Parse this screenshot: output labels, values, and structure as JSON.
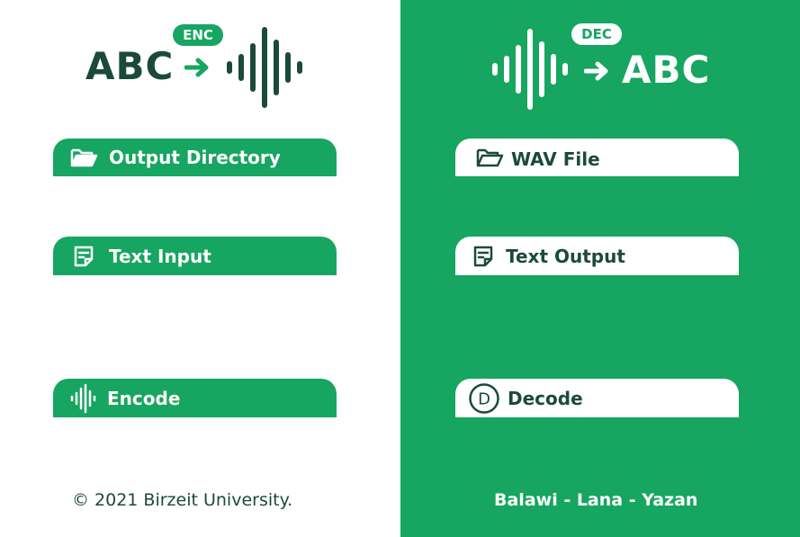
{
  "colors": {
    "brand_green": "#17a562",
    "dark_green": "#1b4a3b",
    "white": "#ffffff"
  },
  "encoder": {
    "logo_text": "ABC",
    "badge": "ENC",
    "output_directory_label": "Output Directory",
    "text_input_label": "Text Input",
    "encode_label": "Encode",
    "footer": "© 2021 Birzeit University.",
    "icons": [
      "arrow-right-icon",
      "sound-wave-icon",
      "folder-open-icon",
      "note-icon",
      "sound-wave-icon"
    ]
  },
  "decoder": {
    "logo_text": "ABC",
    "badge": "DEC",
    "wav_file_label": "WAV File",
    "text_output_label": "Text Output",
    "decode_label": "Decode",
    "footer": "Balawi - Lana - Yazan",
    "icons": [
      "sound-wave-icon",
      "arrow-right-icon",
      "folder-open-icon",
      "note-icon",
      "d-circle-icon"
    ]
  }
}
